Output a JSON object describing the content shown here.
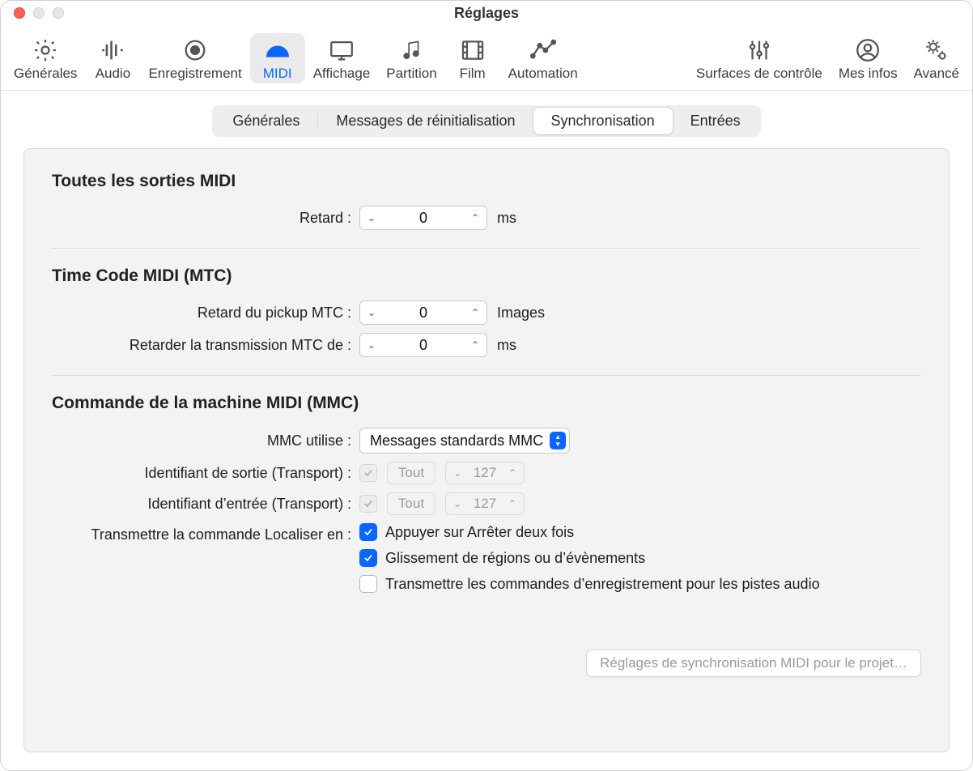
{
  "window": {
    "title": "Réglages"
  },
  "toolbar": {
    "items": [
      {
        "id": "generales",
        "label": "Générales"
      },
      {
        "id": "audio",
        "label": "Audio"
      },
      {
        "id": "enreg",
        "label": "Enregistrement"
      },
      {
        "id": "midi",
        "label": "MIDI"
      },
      {
        "id": "affichage",
        "label": "Affichage"
      },
      {
        "id": "partition",
        "label": "Partition"
      },
      {
        "id": "film",
        "label": "Film"
      },
      {
        "id": "automation",
        "label": "Automation"
      },
      {
        "id": "surfaces",
        "label": "Surfaces de contrôle"
      },
      {
        "id": "mesinfos",
        "label": "Mes infos"
      },
      {
        "id": "avance",
        "label": "Avancé"
      }
    ],
    "active": "midi"
  },
  "subtabs": {
    "items": [
      "Générales",
      "Messages de réinitialisation",
      "Synchronisation",
      "Entrées"
    ],
    "active_index": 2
  },
  "sections": {
    "midi_out": {
      "title": "Toutes les sorties MIDI",
      "delay_label": "Retard :",
      "delay_value": "0",
      "delay_unit": "ms"
    },
    "mtc": {
      "title": "Time Code MIDI (MTC)",
      "pickup_label": "Retard du pickup MTC :",
      "pickup_value": "0",
      "pickup_unit": "Images",
      "tx_label": "Retarder la transmission MTC de :",
      "tx_value": "0",
      "tx_unit": "ms"
    },
    "mmc": {
      "title": "Commande de la machine MIDI (MMC)",
      "uses_label": "MMC utilise :",
      "uses_value": "Messages standards MMC",
      "out_id_label": "Identifiant de sortie (Transport) :",
      "out_id_all_label": "Tout",
      "out_id_value": "127",
      "in_id_label": "Identifiant d’entrée (Transport) :",
      "in_id_all_label": "Tout",
      "in_id_value": "127",
      "locate_label": "Transmettre la commande Localiser en :",
      "locate_opt1": "Appuyer sur Arrêter deux fois",
      "locate_opt2": "Glissement de régions ou d’évènements",
      "locate_opt3": "Transmettre les commandes d’enregistrement pour les pistes audio"
    }
  },
  "footer": {
    "project_sync_button": "Réglages de synchronisation MIDI pour le projet…"
  }
}
